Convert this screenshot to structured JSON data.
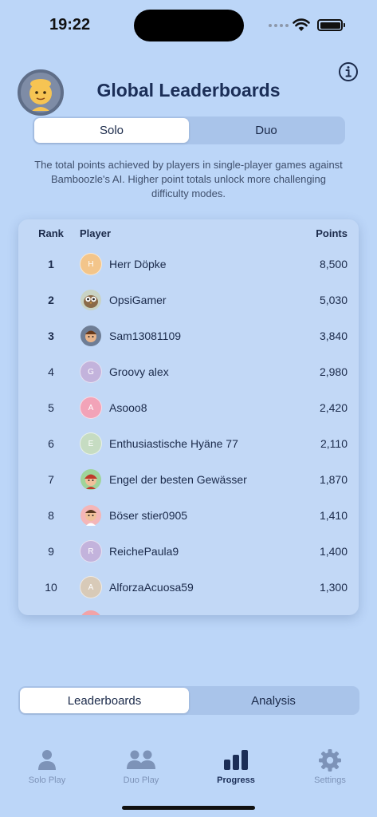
{
  "status_bar": {
    "time": "19:22"
  },
  "header": {
    "title": "Global Leaderboards"
  },
  "mode_tabs": [
    {
      "label": "Solo",
      "active": true
    },
    {
      "label": "Duo",
      "active": false
    }
  ],
  "description": "The total points achieved by players in single-player games against Bamboozle's AI. Higher point totals unlock more challenging difficulty modes.",
  "table": {
    "columns": {
      "rank": "Rank",
      "player": "Player",
      "points": "Points"
    },
    "rows": [
      {
        "rank": "1",
        "name": "Herr Döpke",
        "points": "8,500",
        "initial": "H",
        "avatar_color": "#f3c58a",
        "avatar_type": "letter"
      },
      {
        "rank": "2",
        "name": "OpsiGamer",
        "points": "5,030",
        "initial": "",
        "avatar_color": "#c9d3c4",
        "avatar_type": "owl"
      },
      {
        "rank": "3",
        "name": "Sam13081109",
        "points": "3,840",
        "initial": "",
        "avatar_color": "#6e7d95",
        "avatar_type": "face"
      },
      {
        "rank": "4",
        "name": "Groovy alex",
        "points": "2,980",
        "initial": "G",
        "avatar_color": "#c3b3dc",
        "avatar_type": "letter"
      },
      {
        "rank": "5",
        "name": "Asooo8",
        "points": "2,420",
        "initial": "A",
        "avatar_color": "#f2a3b8",
        "avatar_type": "letter"
      },
      {
        "rank": "6",
        "name": "Enthusiastische Hyäne 77",
        "points": "2,110",
        "initial": "E",
        "avatar_color": "#c6dcc2",
        "avatar_type": "letter"
      },
      {
        "rank": "7",
        "name": "Engel der besten Gewässer",
        "points": "1,870",
        "initial": "",
        "avatar_color": "#9fd49a",
        "avatar_type": "face-red"
      },
      {
        "rank": "8",
        "name": "Böser stier0905",
        "points": "1,410",
        "initial": "",
        "avatar_color": "#f4b6b8",
        "avatar_type": "face-brown"
      },
      {
        "rank": "9",
        "name": "ReichePaula9",
        "points": "1,400",
        "initial": "R",
        "avatar_color": "#c3b3dc",
        "avatar_type": "letter"
      },
      {
        "rank": "10",
        "name": "AlforzaAcuosa59",
        "points": "1,300",
        "initial": "A",
        "avatar_color": "#d8cab8",
        "avatar_type": "letter"
      }
    ]
  },
  "view_tabs": [
    {
      "label": "Leaderboards",
      "active": true
    },
    {
      "label": "Analysis",
      "active": false
    }
  ],
  "tabbar": [
    {
      "label": "Solo Play",
      "icon": "person-icon",
      "active": false
    },
    {
      "label": "Duo Play",
      "icon": "two-people-icon",
      "active": false
    },
    {
      "label": "Progress",
      "icon": "bar-chart-icon",
      "active": true
    },
    {
      "label": "Settings",
      "icon": "gear-icon",
      "active": false
    }
  ],
  "colors": {
    "background": "#bcd6f8",
    "title": "#1b2e57",
    "tab_inactive": "#7d93b8",
    "tab_active": "#1b2e57"
  }
}
